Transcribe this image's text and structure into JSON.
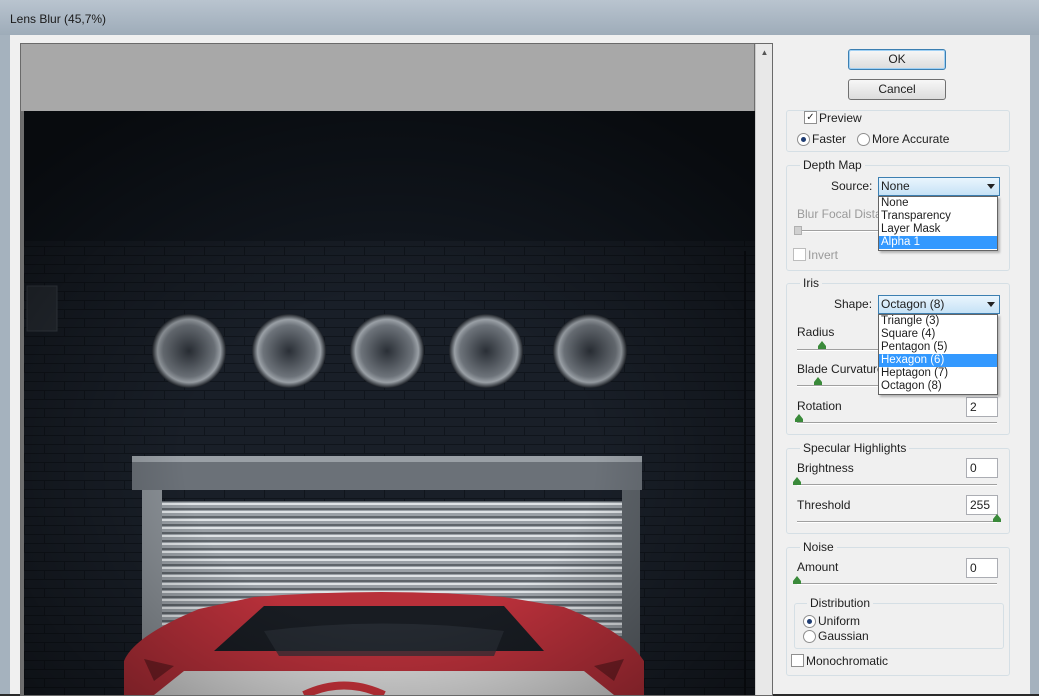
{
  "window": {
    "title": "Lens Blur (45,7%)"
  },
  "buttons": {
    "ok": "OK",
    "cancel": "Cancel"
  },
  "preview": {
    "label": "Preview",
    "checked": true,
    "faster": "Faster",
    "more_accurate": "More Accurate",
    "mode_selected": "Faster"
  },
  "depth_map": {
    "title": "Depth Map",
    "source_label": "Source:",
    "source_value": "None",
    "source_options": [
      "None",
      "Transparency",
      "Layer Mask",
      "Alpha 1"
    ],
    "source_highlighted": "Alpha 1",
    "focal_label": "Blur Focal Distance",
    "invert_label": "Invert"
  },
  "iris": {
    "title": "Iris",
    "shape_label": "Shape:",
    "shape_value": "Octagon (8)",
    "shape_options": [
      "Triangle (3)",
      "Square (4)",
      "Pentagon (5)",
      "Hexagon (6)",
      "Heptagon (7)",
      "Octagon (8)"
    ],
    "shape_highlighted": "Hexagon (6)",
    "radius_label": "Radius",
    "blade_label": "Blade Curvature",
    "rotation_label": "Rotation",
    "rotation_value": "2"
  },
  "specular": {
    "title": "Specular Highlights",
    "brightness_label": "Brightness",
    "brightness_value": "0",
    "threshold_label": "Threshold",
    "threshold_value": "255"
  },
  "noise": {
    "title": "Noise",
    "amount_label": "Amount",
    "amount_value": "0",
    "distribution_title": "Distribution",
    "uniform": "Uniform",
    "gaussian": "Gaussian",
    "distribution_selected": "Uniform",
    "monochromatic": "Monochromatic",
    "monochromatic_checked": false
  },
  "colors": {
    "accent": "#3399ff",
    "slider_thumb": "#3a8a3a",
    "car_red": "#c8323a"
  }
}
